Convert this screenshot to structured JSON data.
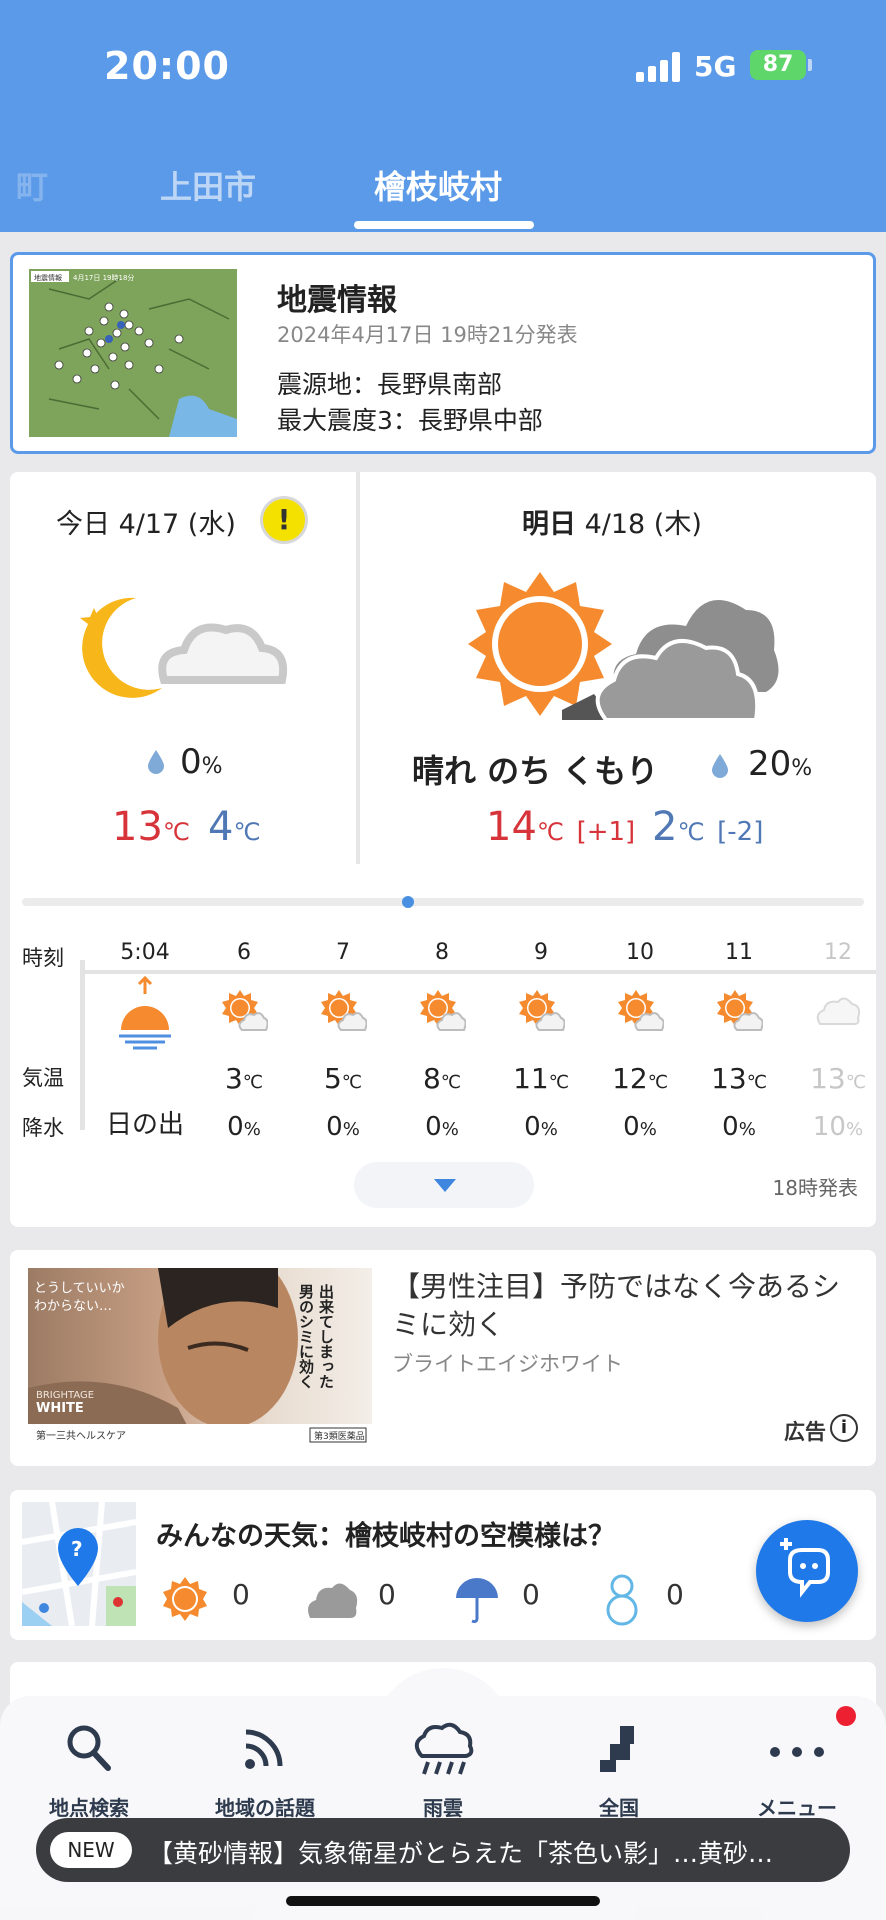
{
  "status_bar": {
    "time": "20:00",
    "network": "5G",
    "battery": "87"
  },
  "tabs": {
    "prev": "町",
    "ueda": "上田市",
    "active": "檜枝岐村"
  },
  "quake": {
    "title": "地震情報",
    "date": "2024年4月17日 19時21分発表",
    "epicenter": "震源地：長野県南部",
    "max_intensity": "最大震度3：長野県中部",
    "map_tag": "地震情報",
    "map_date": "4月17日 19時18分"
  },
  "today": {
    "label": "今日 4/17 (水)",
    "warning_icon": "!",
    "icon": "moon-cloud-icon",
    "precip": "0",
    "pct_unit": "%",
    "high": "13",
    "low": "4",
    "unit": "℃"
  },
  "tomorrow": {
    "label_bold": "明日",
    "label": "4/18 (木)",
    "desc": "晴れ のち くもり",
    "icon": "sun-then-cloud-icon",
    "precip": "20",
    "pct_unit": "%",
    "high": "14",
    "high_diff": "[+1]",
    "low": "2",
    "low_diff": "[-2]",
    "unit": "℃"
  },
  "hourly": {
    "row_labels": {
      "time": "時刻",
      "temp": "気温",
      "precip": "降水"
    },
    "unit_temp": "℃",
    "unit_pct": "%",
    "cols": [
      {
        "h": "5:04",
        "icon": "sunrise-icon",
        "t": "",
        "p": "日の出",
        "special": true
      },
      {
        "h": "6",
        "icon": "sun-cloud-icon",
        "t": "3",
        "p": "0"
      },
      {
        "h": "7",
        "icon": "sun-cloud-icon",
        "t": "5",
        "p": "0"
      },
      {
        "h": "8",
        "icon": "sun-cloud-icon",
        "t": "8",
        "p": "0"
      },
      {
        "h": "9",
        "icon": "sun-cloud-icon",
        "t": "11",
        "p": "0"
      },
      {
        "h": "10",
        "icon": "sun-cloud-icon",
        "t": "12",
        "p": "0"
      },
      {
        "h": "11",
        "icon": "sun-cloud-icon",
        "t": "13",
        "p": "0"
      },
      {
        "h": "12",
        "icon": "cloud-icon",
        "t": "13",
        "p": "10",
        "fade": true
      }
    ],
    "issued": "18時発表"
  },
  "ad": {
    "title": "【男性注目】予防ではなく今あるシミに効く",
    "sponsor": "ブライトエイジホワイト",
    "label": "広告",
    "img_copy_1": "とうしていいか",
    "img_copy_2": "わからない…",
    "img_vertical_1": "出来てしまった",
    "img_vertical_2": "男のシミに効く",
    "img_brand_1": "BRIGHTAGE",
    "img_brand_2": "WHITE",
    "img_maker": "第一三共ヘルスケア",
    "img_badge": "第3類医薬品"
  },
  "minna": {
    "title": "みんなの天気：檜枝岐村の空模様は？",
    "votes": [
      {
        "icon": "sun-icon",
        "count": "0"
      },
      {
        "icon": "cloud-icon",
        "count": "0"
      },
      {
        "icon": "umbrella-icon",
        "count": "0"
      },
      {
        "icon": "snowman-icon",
        "count": "0"
      }
    ]
  },
  "bottom_nav": {
    "search": "地点検索",
    "topics": "地域の話題",
    "rain": "雨雲",
    "national": "全国",
    "menu": "メニュー"
  },
  "ticker": {
    "badge": "NEW",
    "text": "【黄砂情報】気象衛星がとらえた「茶色い影」…黄砂…"
  },
  "colors": {
    "header": "#5b9ae8",
    "hot": "#d6343a",
    "cold": "#4f78b5",
    "fab": "#1f79e8",
    "sun": "#f58a2e"
  }
}
